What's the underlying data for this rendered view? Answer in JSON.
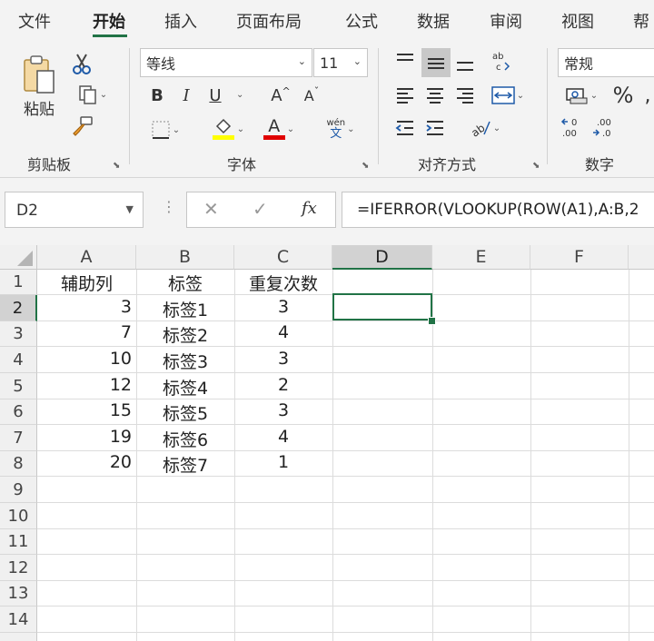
{
  "menu": {
    "tabs": [
      "文件",
      "开始",
      "插入",
      "页面布局",
      "公式",
      "数据",
      "审阅",
      "视图",
      "帮"
    ],
    "active": "开始"
  },
  "ribbon": {
    "clipboard": {
      "paste_label": "粘贴",
      "group_label": "剪贴板"
    },
    "font": {
      "font_name": "等线",
      "font_size": "11",
      "bold": "B",
      "italic": "I",
      "underline": "U",
      "grow": "A",
      "shrink": "A",
      "phonetic_top": "wén",
      "phonetic_bottom": "文",
      "font_color_letter": "A",
      "group_label": "字体"
    },
    "alignment": {
      "group_label": "对齐方式"
    },
    "number": {
      "format": "常规",
      "percent": "%",
      "group_label": "数字"
    },
    "colors": {
      "accent": "#217346",
      "highlight": "#ffff00",
      "font_color": "#e00000"
    }
  },
  "formula_bar": {
    "name_box": "D2",
    "cancel": "✕",
    "enter": "✓",
    "fx": "fx",
    "formula": "=IFERROR(VLOOKUP(ROW(A1),A:B,2"
  },
  "sheet": {
    "columns": [
      "A",
      "B",
      "C",
      "D",
      "E",
      "F"
    ],
    "rows": [
      "1",
      "2",
      "3",
      "4",
      "5",
      "6",
      "7",
      "8",
      "9",
      "10",
      "11",
      "12",
      "13",
      "14"
    ],
    "selected_cell": "D2",
    "header_row": [
      "辅助列",
      "标签",
      "重复次数"
    ],
    "data": [
      {
        "a": "3",
        "b": "标签1",
        "c": "3"
      },
      {
        "a": "7",
        "b": "标签2",
        "c": "4"
      },
      {
        "a": "10",
        "b": "标签3",
        "c": "3"
      },
      {
        "a": "12",
        "b": "标签4",
        "c": "2"
      },
      {
        "a": "15",
        "b": "标签5",
        "c": "3"
      },
      {
        "a": "19",
        "b": "标签6",
        "c": "4"
      },
      {
        "a": "20",
        "b": "标签7",
        "c": "1"
      }
    ]
  }
}
